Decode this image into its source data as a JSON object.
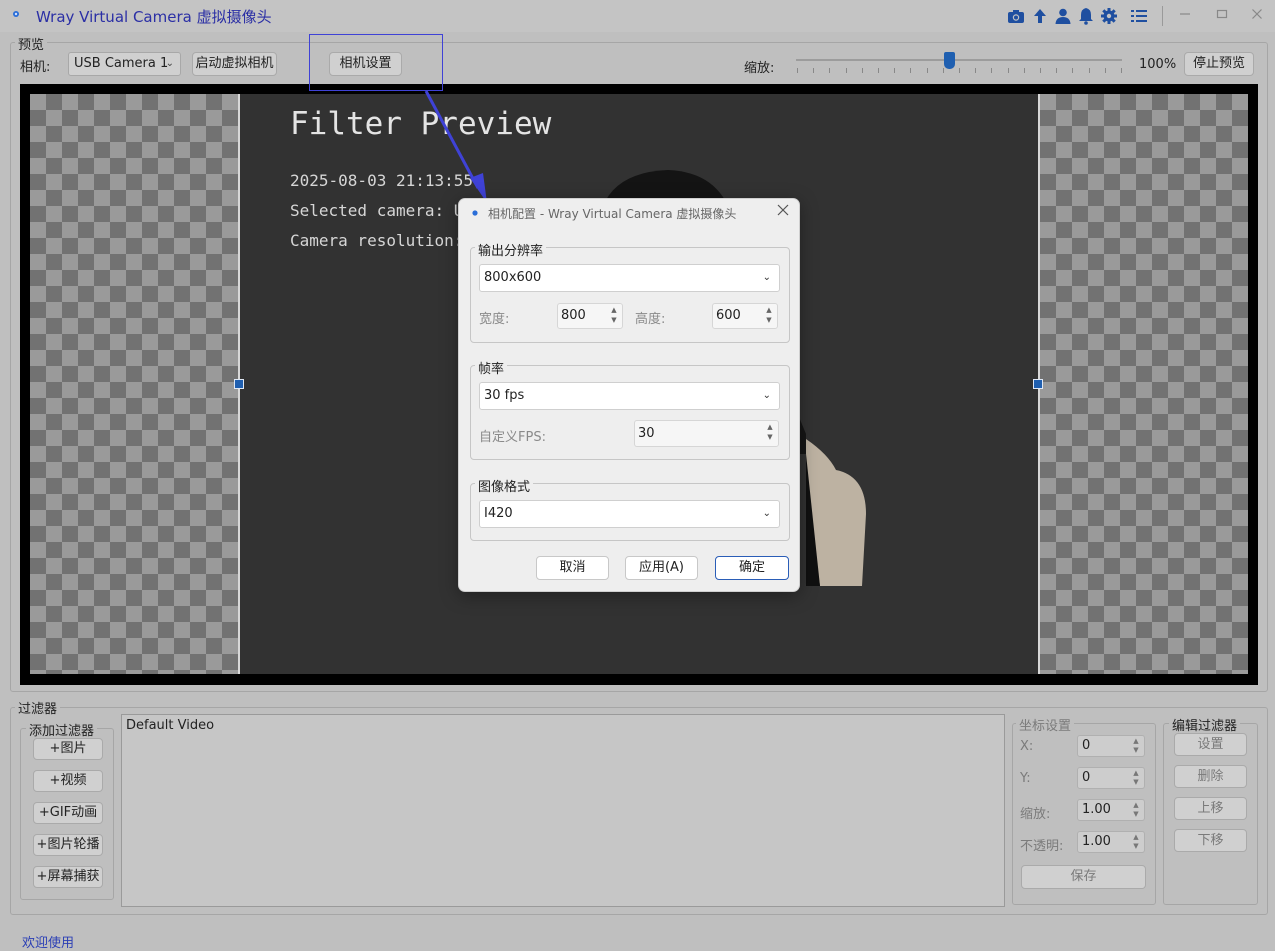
{
  "app": {
    "title": "Wray Virtual Camera 虚拟摄像头",
    "icon": "app-camera-icon",
    "toolbar_icons": [
      "camera-icon",
      "upload-arrow-icon",
      "user-icon",
      "bell-icon",
      "gear-icon",
      "list-icon"
    ],
    "window_controls": [
      "minimize",
      "maximize",
      "close"
    ]
  },
  "preview": {
    "group_title": "预览",
    "camera_label": "相机:",
    "camera_value": "USB Camera 1",
    "start_virtual_label": "启动虚拟相机",
    "camera_settings_label": "相机设置",
    "zoom_label": "缩放:",
    "zoom_value": "100%",
    "zoom_level_fraction": 0.47,
    "stop_preview_label": "停止预览",
    "overlay_title": "Filter Preview",
    "overlay_lines": [
      "2025-08-03 21:13:55",
      "Selected camera: US",
      "Camera resolution: 8"
    ]
  },
  "dialog": {
    "title": "相机配置 - Wray Virtual Camera 虚拟摄像头",
    "resolution_group": "输出分辨率",
    "resolution_value": "800x600",
    "width_label": "宽度:",
    "width_value": "800",
    "height_label": "高度:",
    "height_value": "600",
    "fps_group": "帧率",
    "fps_value": "30 fps",
    "custom_fps_label": "自定义FPS:",
    "custom_fps_value": "30",
    "format_group": "图像格式",
    "format_value": "I420",
    "cancel_label": "取消",
    "apply_label": "应用(A)",
    "ok_label": "确定"
  },
  "filters": {
    "group_title": "过滤器",
    "add_group_title": "添加过滤器",
    "add_buttons": [
      "+图片",
      "+视频",
      "+GIF动画",
      "+图片轮播",
      "+屏幕捕获"
    ],
    "list_items": [
      "Default Video"
    ],
    "coords_group_title": "坐标设置",
    "x_label": "X:",
    "x_value": "0",
    "y_label": "Y:",
    "y_value": "0",
    "scale_label": "缩放:",
    "scale_value": "1.00",
    "opacity_label": "不透明:",
    "opacity_value": "1.00",
    "save_label": "保存",
    "edit_group_title": "编辑过滤器",
    "settings_label": "设置",
    "delete_label": "删除",
    "up_label": "上移",
    "down_label": "下移"
  },
  "status": {
    "text": "欢迎使用"
  },
  "colors": {
    "title_text": "#2b2fa5",
    "accent": "#1f5fb0",
    "highlight": "#3f42d6"
  }
}
